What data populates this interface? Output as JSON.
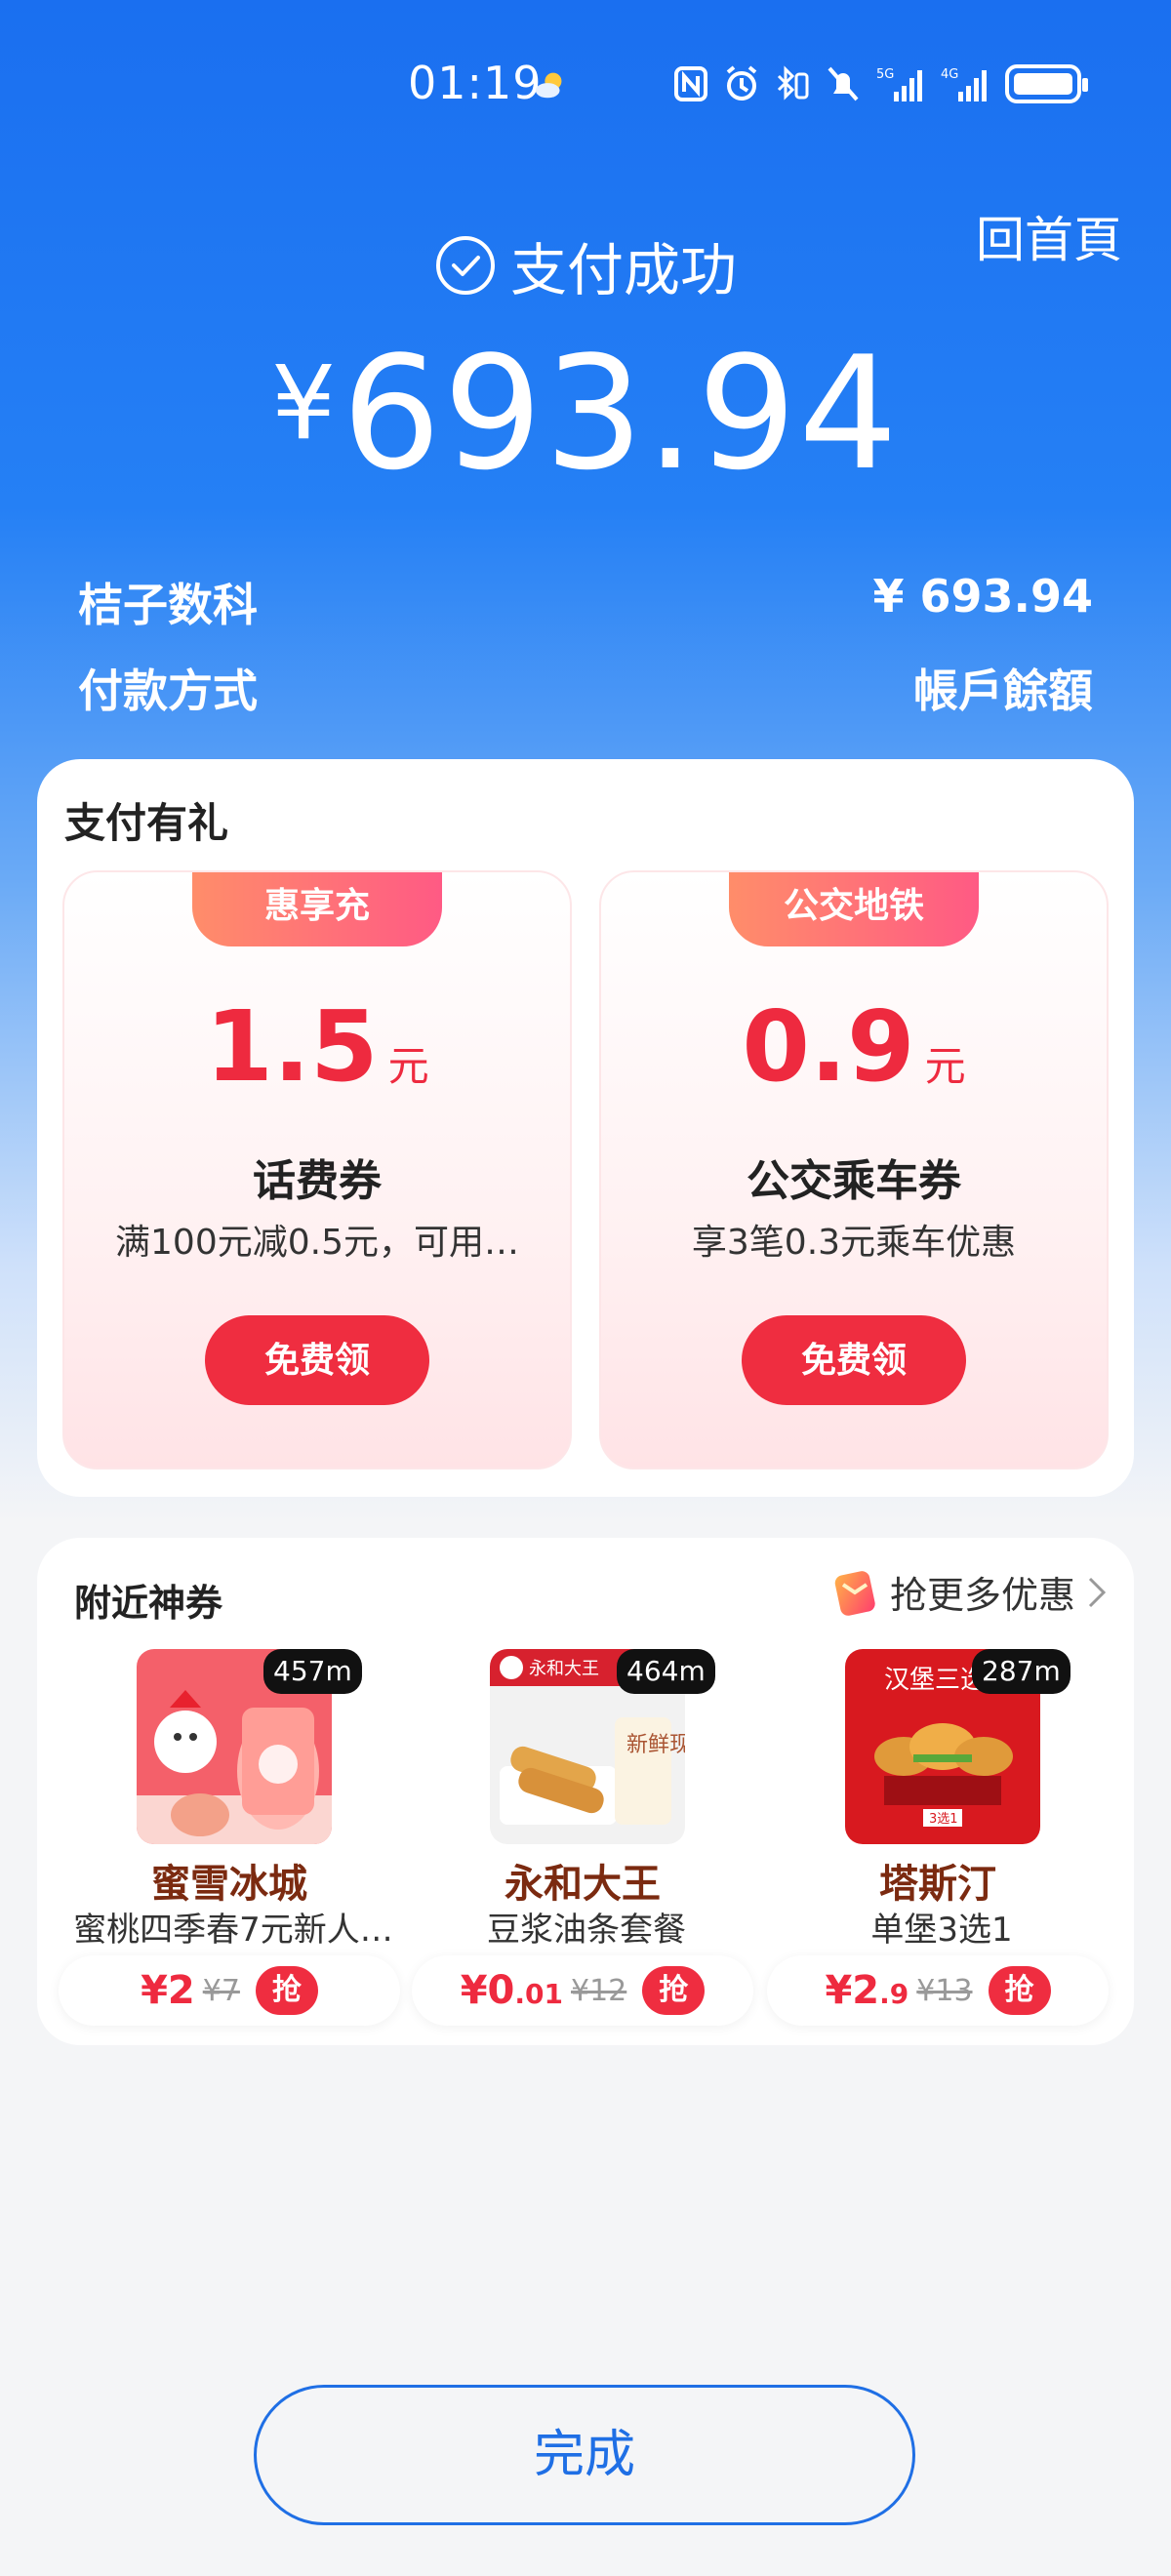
{
  "status_bar": {
    "time": "01:19",
    "network_5g": "5G",
    "network_4g": "4G"
  },
  "header": {
    "home_link": "回首頁",
    "success_text": "支付成功",
    "currency": "¥",
    "amount": "693.94"
  },
  "details": {
    "merchant_label": "桔子数科",
    "merchant_value": "¥ 693.94",
    "method_label": "付款方式",
    "method_value": "帳戶餘額"
  },
  "gifts": {
    "title": "支付有礼",
    "coupons": [
      {
        "tag": "惠享充",
        "amount": "1.5",
        "unit": "元",
        "name": "话费券",
        "desc": "满100元减0.5元，可用…",
        "button": "免费领"
      },
      {
        "tag": "公交地铁",
        "amount": "0.9",
        "unit": "元",
        "name": "公交乘车券",
        "desc": "享3笔0.3元乘车优惠",
        "button": "免费领"
      }
    ]
  },
  "nearby": {
    "title": "附近神券",
    "more": "抢更多优惠",
    "deals": [
      {
        "distance": "457m",
        "name": "蜜雪冰城",
        "desc": "蜜桃四季春7元新人…",
        "price_main": "¥2",
        "price_small": "",
        "was": "¥7",
        "grab": "抢"
      },
      {
        "distance": "464m",
        "name": "永和大王",
        "desc": "豆浆油条套餐",
        "price_main": "¥0",
        "price_small": ".01",
        "was": "¥12",
        "grab": "抢",
        "logo_text": "永和大王",
        "img_text": "新鲜现磨"
      },
      {
        "distance": "287m",
        "name": "塔斯汀",
        "desc": "单堡3选1",
        "price_main": "¥2",
        "price_small": ".9",
        "was": "¥13",
        "grab": "抢",
        "img_text": "汉堡三选",
        "img_badge": "3选1"
      }
    ]
  },
  "done_button": "完成",
  "colors": {
    "primary_blue": "#1a6ff0",
    "accent_red": "#ee2a3f",
    "tag_gradient_start": "#ff8d6a",
    "tag_gradient_end": "#ff5a84"
  }
}
